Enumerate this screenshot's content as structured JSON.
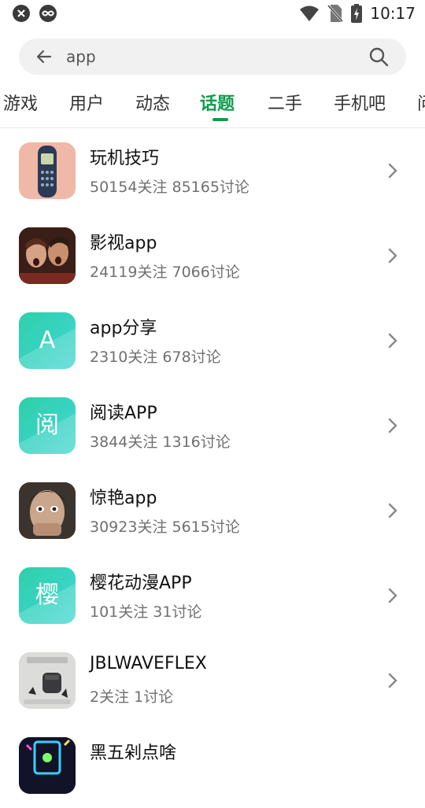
{
  "status_bar": {
    "time": "10:17",
    "left_icons": [
      "shield-icon",
      "link-icon"
    ],
    "right_icons": [
      "wifi-icon",
      "no-sim-icon",
      "battery-charging-icon"
    ]
  },
  "search": {
    "query": "app"
  },
  "tabs": [
    {
      "label": "游戏"
    },
    {
      "label": "用户"
    },
    {
      "label": "动态"
    },
    {
      "label": "话题"
    },
    {
      "label": "二手"
    },
    {
      "label": "手机吧"
    },
    {
      "label": "问"
    }
  ],
  "active_tab": "话题",
  "colors": {
    "accent": "#119a4b"
  },
  "topics": [
    {
      "title": "玩机技巧",
      "meta": "50154关注 85165讨论",
      "thumb": "phone-image"
    },
    {
      "title": "影视app",
      "meta": "24119关注 7066讨论",
      "thumb": "movie-image"
    },
    {
      "title": "app分享",
      "meta": "2310关注 678讨论",
      "thumb": "letter",
      "letter": "A"
    },
    {
      "title": "阅读APP",
      "meta": "3844关注 1316讨论",
      "thumb": "letter",
      "letter": "阅"
    },
    {
      "title": "惊艳app",
      "meta": "30923关注 5615讨论",
      "thumb": "face-image"
    },
    {
      "title": "樱花动漫APP",
      "meta": "101关注 31讨论",
      "thumb": "letter",
      "letter": "樱"
    },
    {
      "title": "JBLWAVEFLEX",
      "meta": "2关注 1讨论",
      "thumb": "earbuds-image"
    },
    {
      "title": "黑五剁点啥",
      "meta": "",
      "thumb": "neon-image"
    }
  ]
}
